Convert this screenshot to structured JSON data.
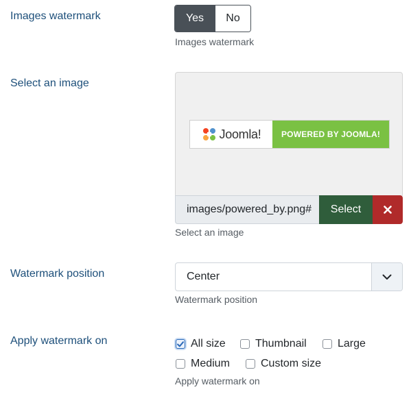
{
  "images_watermark": {
    "label": "Images watermark",
    "options": [
      "Yes",
      "No"
    ],
    "selected": "Yes",
    "description": "Images watermark"
  },
  "select_image": {
    "label": "Select an image",
    "preview": {
      "logo_text": "Joomla!",
      "badge_text": "POWERED BY JOOMLA!"
    },
    "path_value": "images/powered_by.png#",
    "select_button": "Select",
    "clear_button_icon": "times-icon",
    "description": "Select an image"
  },
  "watermark_position": {
    "label": "Watermark position",
    "value": "Center",
    "description": "Watermark position"
  },
  "apply_watermark": {
    "label": "Apply watermark on",
    "options": [
      {
        "label": "All size",
        "checked": true
      },
      {
        "label": "Thumbnail",
        "checked": false
      },
      {
        "label": "Large",
        "checked": false
      },
      {
        "label": "Medium",
        "checked": false
      },
      {
        "label": "Custom size",
        "checked": false
      }
    ],
    "description": "Apply watermark on"
  },
  "colors": {
    "label_blue": "#1d4f7a",
    "switch_active": "#495057",
    "select_green": "#2f5d3b",
    "clear_red": "#b02a2a",
    "joomla_green": "#7ac143"
  }
}
